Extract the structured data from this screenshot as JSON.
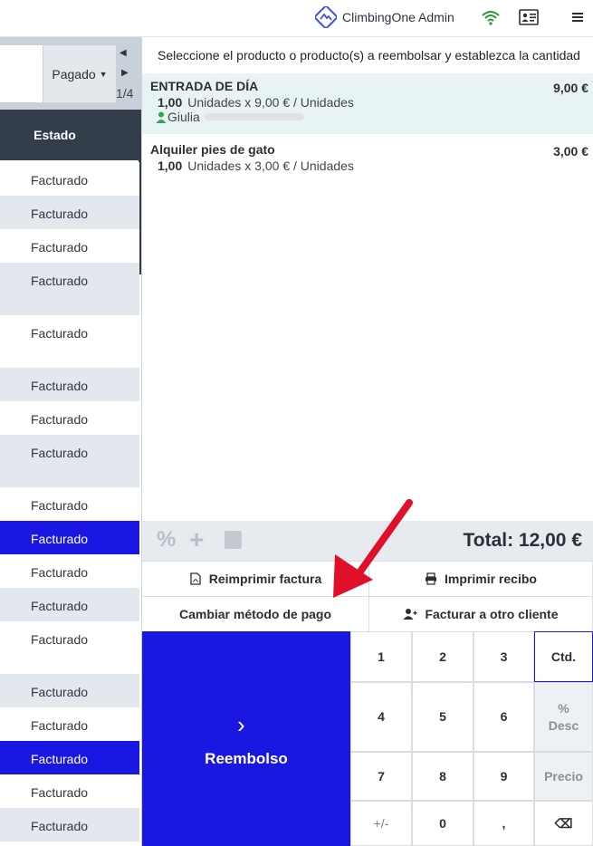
{
  "app": {
    "title": "ClimbingOne Admin"
  },
  "topbar": {
    "icons": [
      "logo-icon",
      "wifi-icon",
      "id-card-icon",
      "menu-icon"
    ]
  },
  "left_panel": {
    "filter": {
      "value": "Pagado"
    },
    "pager": {
      "count": "1/4"
    },
    "column_header": "Estado",
    "rows": [
      {
        "status": "Facturado",
        "style": "white"
      },
      {
        "status": "Facturado",
        "style": "grey"
      },
      {
        "status": "Facturado",
        "style": "white"
      },
      {
        "status": "Facturado",
        "style": "grey"
      },
      {
        "status": "Facturado",
        "style": "white"
      },
      {
        "status": "Facturado",
        "style": "grey"
      },
      {
        "status": "Facturado",
        "style": "white"
      },
      {
        "status": "Facturado",
        "style": "grey"
      },
      {
        "status": "Facturado",
        "style": "white"
      },
      {
        "status": "Facturado",
        "style": "selected"
      },
      {
        "status": "Facturado",
        "style": "white"
      },
      {
        "status": "Facturado",
        "style": "grey"
      },
      {
        "status": "Facturado",
        "style": "white"
      },
      {
        "status": "Facturado",
        "style": "grey"
      },
      {
        "status": "Facturado",
        "style": "white"
      },
      {
        "status": "Facturado",
        "style": "selected"
      },
      {
        "status": "Facturado",
        "style": "white"
      },
      {
        "status": "Facturado",
        "style": "grey"
      }
    ]
  },
  "refund_panel": {
    "instruction": "Seleccione el producto o producto(s) a reembolsar y establezca la cantidad",
    "items": [
      {
        "name": "ENTRADA DE DÍA",
        "price": "9,00 €",
        "qty": "1,00",
        "detail": "Unidades x 9,00 € / Unidades",
        "customer": "Giulia"
      },
      {
        "name": "Alquiler pies de gato",
        "price": "3,00 €",
        "qty": "1,00",
        "detail": "Unidades x 3,00 € / Unidades"
      }
    ],
    "tools": {
      "percent": "%",
      "plus": "+"
    },
    "total": "Total: 12,00 €",
    "actions": {
      "reprint_invoice": "Reimprimir factura",
      "print_receipt": "Imprimir recibo",
      "change_payment": "Cambiar método de pago",
      "invoice_other": "Facturar a otro cliente"
    },
    "refund_button": "Reembolso",
    "keypad": {
      "k1": "1",
      "k2": "2",
      "k3": "3",
      "qty": "Ctd.",
      "k4": "4",
      "k5": "5",
      "k6": "6",
      "disc_pct": "%",
      "disc": "Desc",
      "k7": "7",
      "k8": "8",
      "k9": "9",
      "price": "Precio",
      "sign": "+/-",
      "k0": "0",
      "decimal": ",",
      "backspace": "⌫"
    }
  },
  "colors": {
    "accent": "#1a17e3",
    "header_dark": "#343d4a",
    "row_grey": "#e3e8ef",
    "selected_item": "#e8f4f4",
    "annotation_arrow": "#e0102a"
  }
}
